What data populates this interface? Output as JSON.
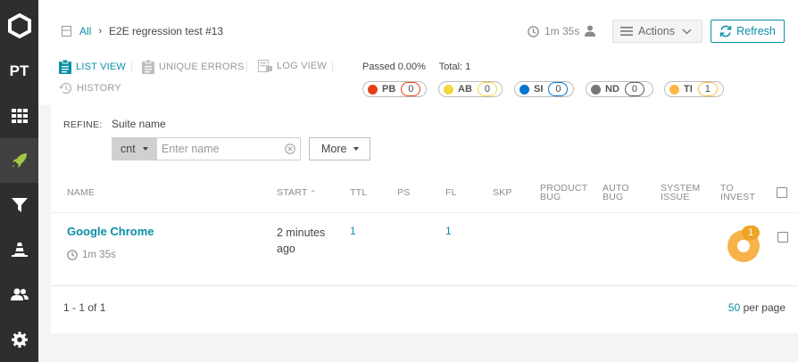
{
  "sidebar": {
    "logo": "logo-icon",
    "project_code": "PT",
    "items": [
      {
        "name": "dashboard",
        "icon": "grid-icon"
      },
      {
        "name": "launches",
        "icon": "rocket-icon"
      },
      {
        "name": "filters",
        "icon": "filter-icon"
      },
      {
        "name": "debug",
        "icon": "cone-icon"
      },
      {
        "name": "members",
        "icon": "users-icon"
      },
      {
        "name": "settings",
        "icon": "gear-icon"
      }
    ]
  },
  "breadcrumb": {
    "root": "All",
    "current": "E2E regression test #13"
  },
  "header": {
    "duration": "1m 35s",
    "actions_label": "Actions",
    "refresh_label": "Refresh"
  },
  "tabs": {
    "list_view": "LIST VIEW",
    "unique_errors": "UNIQUE ERRORS",
    "log_view": "LOG VIEW",
    "history": "HISTORY"
  },
  "stats": {
    "passed": "Passed 0.00%",
    "total": "Total: 1"
  },
  "defects": [
    {
      "code": "PB",
      "count": "0",
      "color": "#e53f15"
    },
    {
      "code": "AB",
      "count": "0",
      "color": "#f7d63e"
    },
    {
      "code": "SI",
      "count": "0",
      "color": "#0274d1"
    },
    {
      "code": "ND",
      "count": "0",
      "color": "#777777"
    },
    {
      "code": "TI",
      "count": "1",
      "color": "#ffb743"
    }
  ],
  "refine": {
    "label": "REFINE:",
    "suite_label": "Suite name",
    "condition": "cnt",
    "name_placeholder": "Enter name",
    "more_label": "More"
  },
  "table": {
    "headers": {
      "name": "NAME",
      "start": "START",
      "ttl": "TTL",
      "ps": "PS",
      "fl": "FL",
      "skp": "SKP",
      "product_bug": [
        "PRODUCT",
        "BUG"
      ],
      "auto_bug": [
        "AUTO",
        "BUG"
      ],
      "system_issue": [
        "SYSTEM",
        "ISSUE"
      ],
      "to_invest": [
        "TO",
        "INVEST"
      ]
    },
    "rows": [
      {
        "name": "Google Chrome",
        "duration": "1m 35s",
        "start": "2 minutes ago",
        "ttl": "1",
        "ps": "",
        "fl": "1",
        "skp": "",
        "to_invest": "1"
      }
    ]
  },
  "pagination": {
    "range": "1 - 1 of 1",
    "per_page_value": "50",
    "per_page_label": "per page"
  }
}
